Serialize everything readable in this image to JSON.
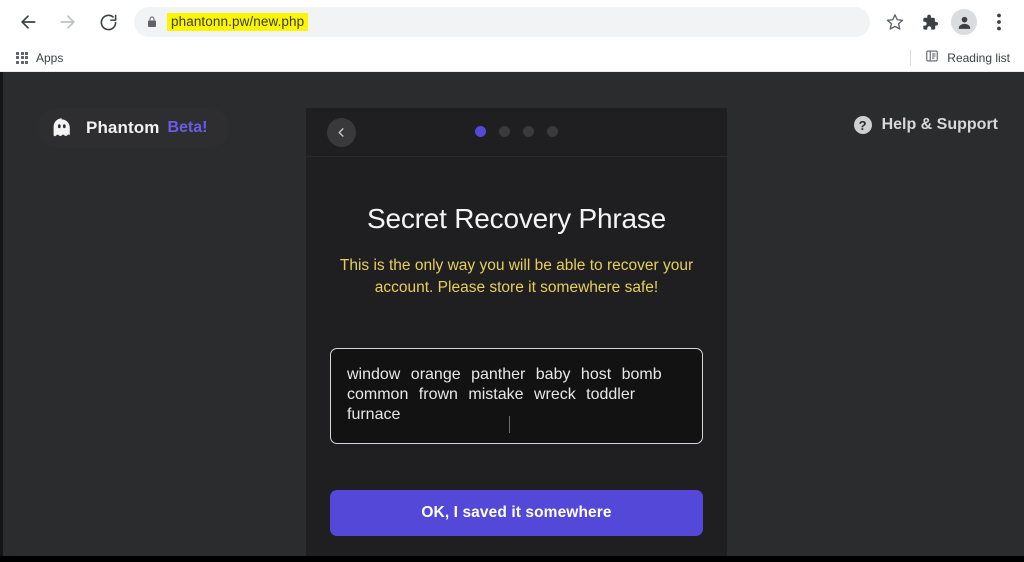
{
  "browser": {
    "back_tooltip": "Back",
    "forward_tooltip": "Forward",
    "reload_tooltip": "Reload",
    "url": "phantonn.pw/new.php",
    "url_highlight_color": "#fbf600",
    "lock_icon": "lock-icon",
    "bookmark_star_icon": "star-icon",
    "extensions_icon": "puzzle-icon",
    "profile_icon": "profile-avatar-icon",
    "menu_icon": "three-dot-menu-icon",
    "bookmarks": {
      "apps_label": "Apps",
      "apps_icon": "apps-grid-icon",
      "reading_list_label": "Reading list",
      "reading_list_icon": "reading-list-icon"
    }
  },
  "page": {
    "background_color": "#2b2c2e",
    "brand": {
      "icon": "phantom-ghost-icon",
      "name": "Phantom",
      "beta_label": "Beta!",
      "beta_color": "#6b5ce7"
    },
    "help": {
      "icon": "question-mark-circle-icon",
      "label": "Help & Support"
    }
  },
  "modal": {
    "background_color": "#1f1f21",
    "back_button_icon": "chevron-left-icon",
    "pagination": {
      "total": 4,
      "active_index": 1,
      "active_color": "#5348d8",
      "inactive_color": "#3a3a3d"
    },
    "title": "Secret Recovery Phrase",
    "warning": "This is the only way you will be able to recover your account. Please store it somewhere safe!",
    "warning_color": "#e5cf5a",
    "recovery_phrase": {
      "words": [
        "window",
        "orange",
        "panther",
        "baby",
        "host",
        "bomb",
        "common",
        "frown",
        "mistake",
        "wreck",
        "toddler",
        "furnace"
      ],
      "text": "window orange panther baby host bomb common frown mistake wreck toddler furnace",
      "word_count": 12
    },
    "confirm_button": {
      "label": "OK, I saved it somewhere",
      "color": "#5348d8"
    }
  }
}
